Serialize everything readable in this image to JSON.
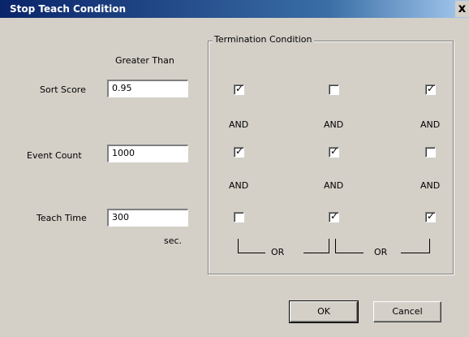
{
  "window": {
    "title": "Stop Teach Condition",
    "close_glyph": "x"
  },
  "column_header": "Greater Than",
  "fields": [
    {
      "label": "Sort Score",
      "value": "0.95"
    },
    {
      "label": "Event Count",
      "value": "1000"
    },
    {
      "label": "Teach Time",
      "value": "300"
    }
  ],
  "unit": "sec.",
  "termination": {
    "legend": "Termination Condition",
    "rows": [
      [
        true,
        false,
        true
      ],
      [
        true,
        true,
        false
      ],
      [
        false,
        true,
        true
      ]
    ],
    "and_label": "AND",
    "or_label": "OR"
  },
  "buttons": {
    "ok": "OK",
    "cancel": "Cancel"
  }
}
